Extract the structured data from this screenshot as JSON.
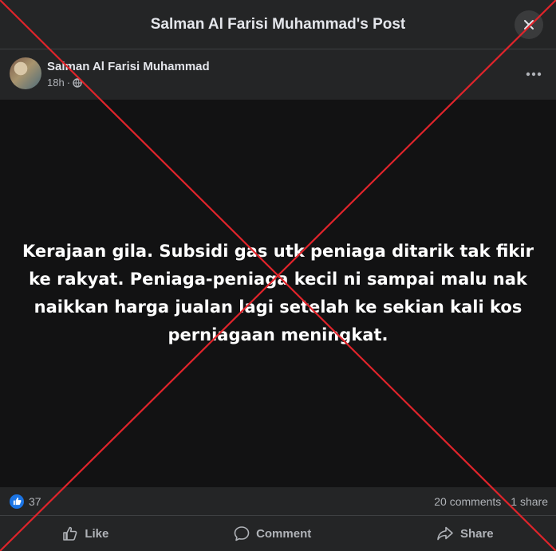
{
  "header": {
    "title": "Salman Al Farisi Muhammad's Post"
  },
  "post": {
    "author": "Salman Al Farisi Muhammad",
    "time": "18h",
    "separator": "·",
    "privacy_icon": "globe-icon",
    "text": "Kerajaan gila. Subsidi gas utk peniaga ditarik tak fikir ke rakyat. Peniaga-peniaga kecil ni sampai malu nak naikkan harga jualan lagi setelah ke sekian kali kos perniagaan meningkat."
  },
  "stats": {
    "reaction_count": "37",
    "comments": "20 comments",
    "shares": "1 share"
  },
  "actions": {
    "like_label": "Like",
    "comment_label": "Comment",
    "share_label": "Share"
  },
  "colors": {
    "background": "#242526",
    "post_background": "#121213",
    "accent_blue": "#1b74e4",
    "overlay_cross": "#e0242b"
  }
}
